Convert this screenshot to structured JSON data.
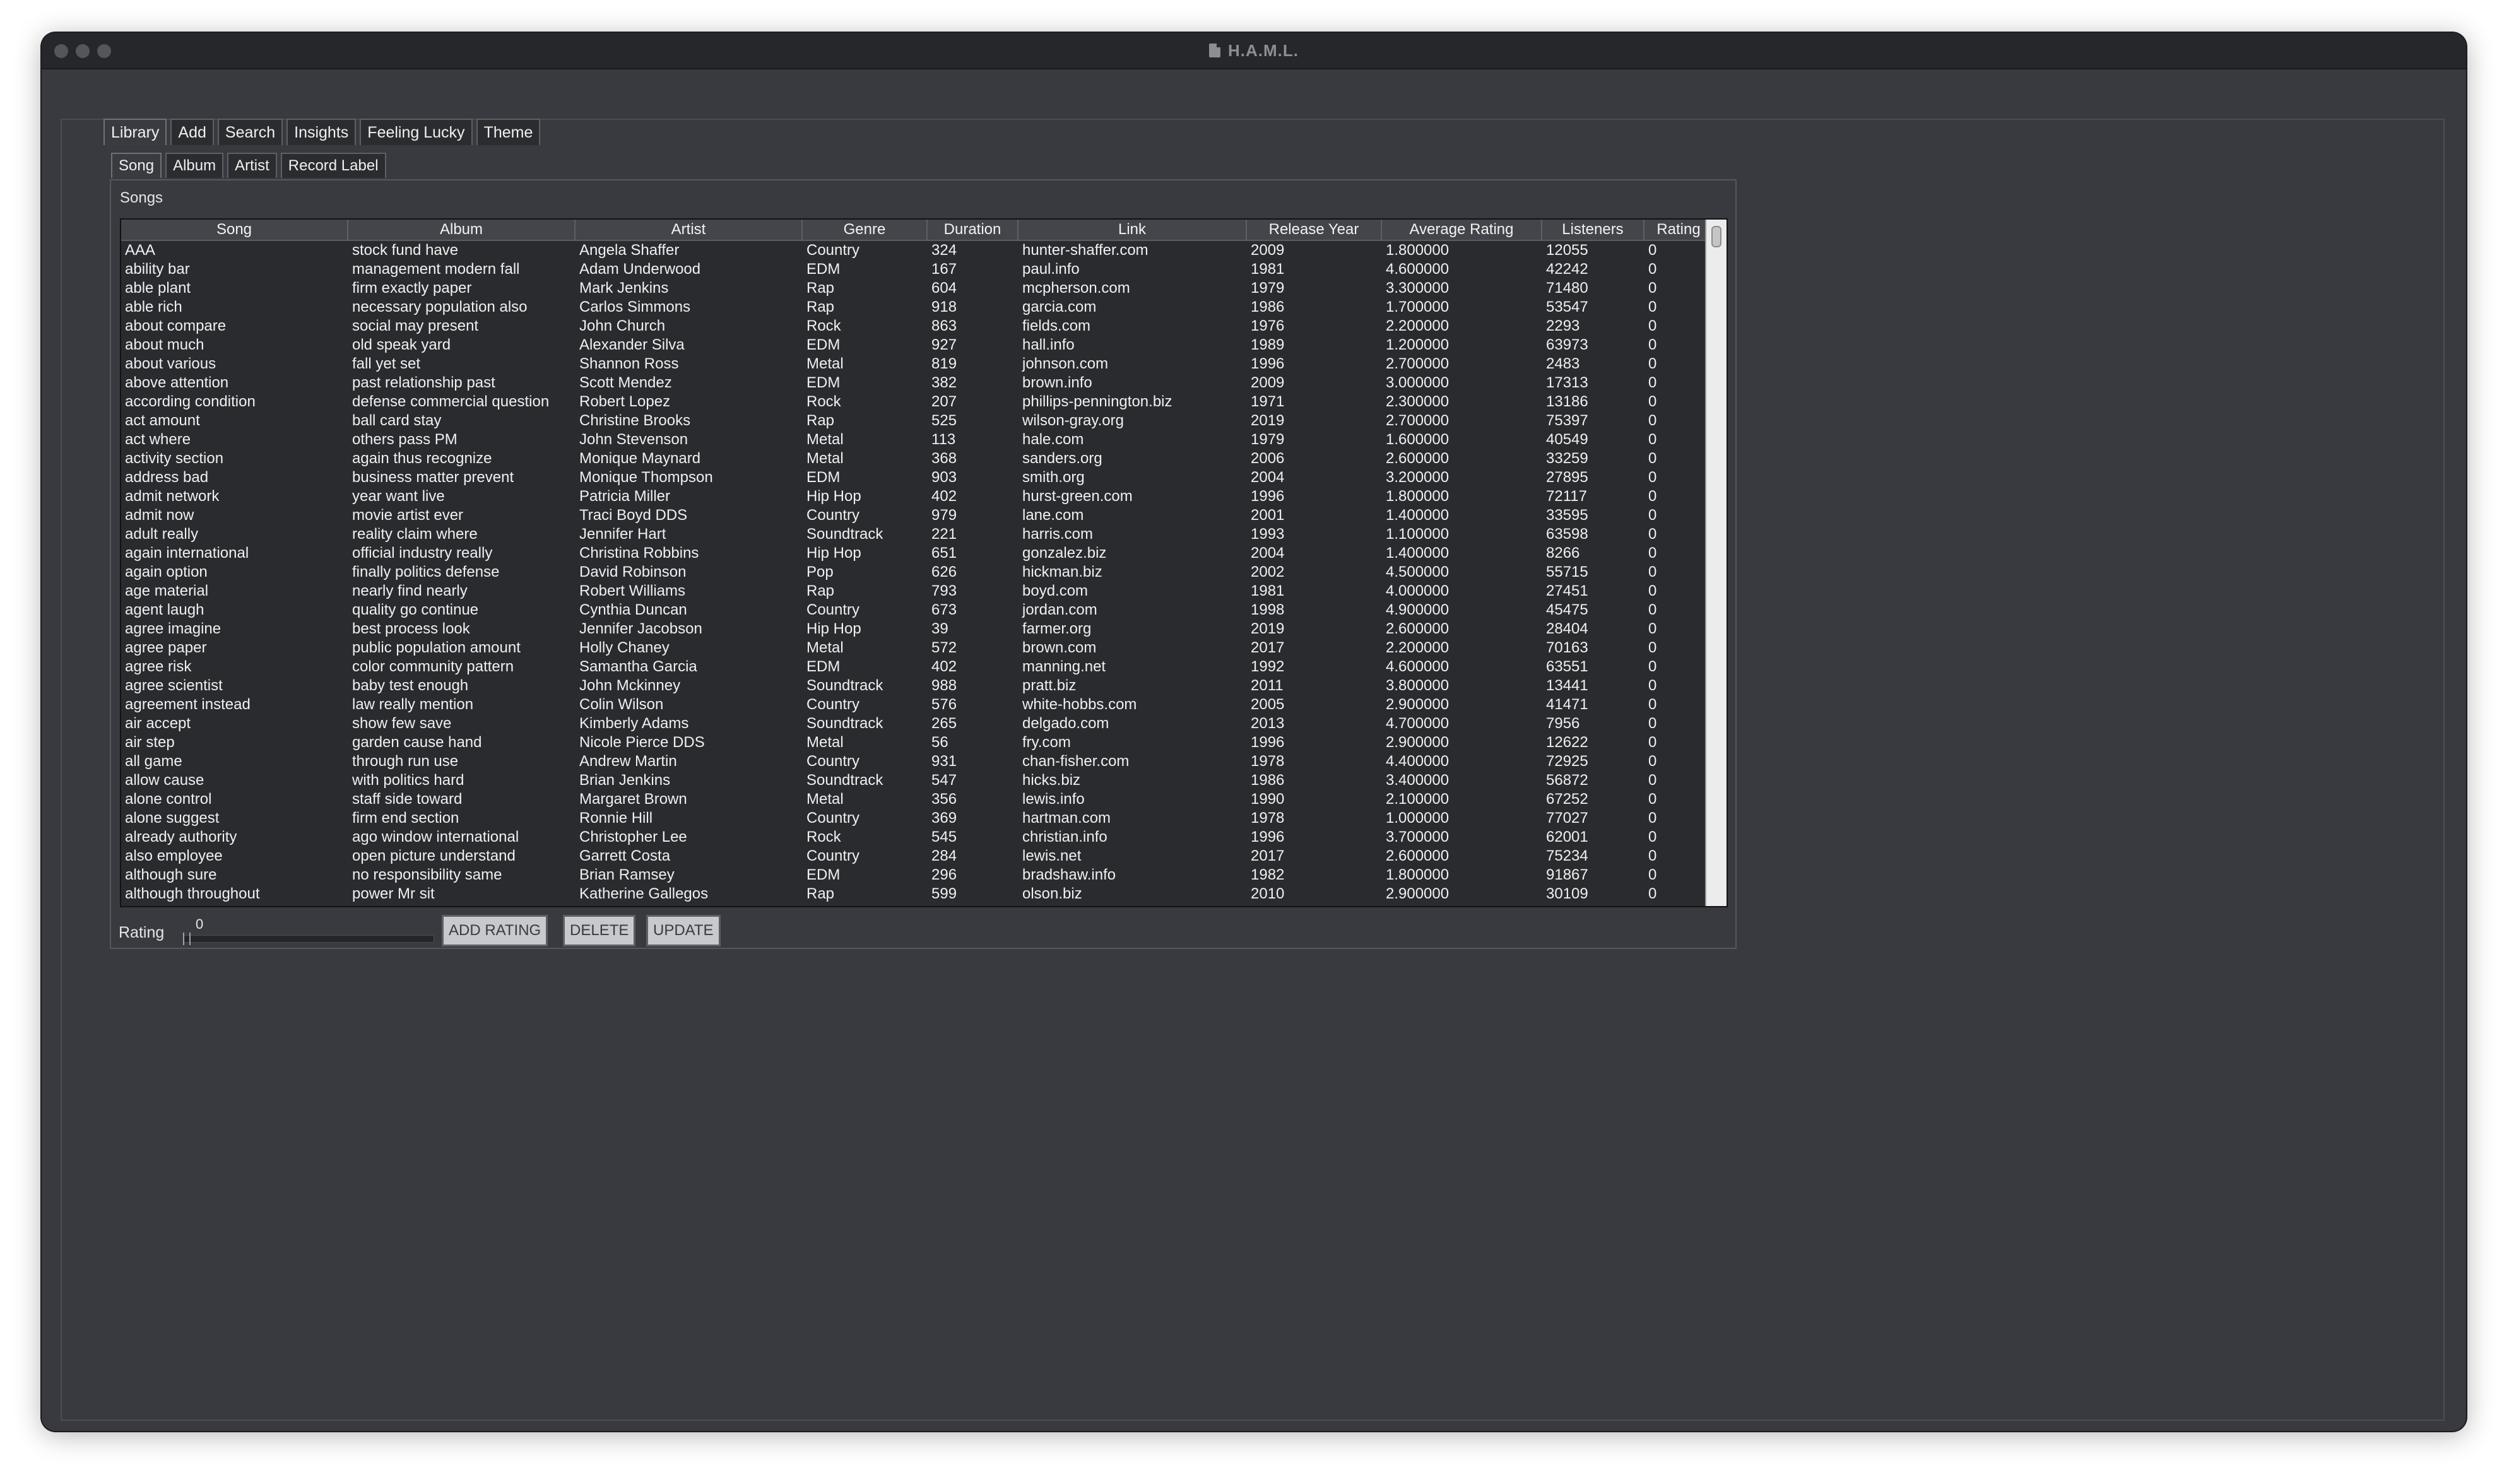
{
  "window": {
    "title": "H.A.M.L."
  },
  "main_tabs": [
    "Library",
    "Add",
    "Search",
    "Insights",
    "Feeling Lucky",
    "Theme"
  ],
  "sub_tabs": [
    "Song",
    "Album",
    "Artist",
    "Record Label"
  ],
  "panel": {
    "title": "Songs"
  },
  "table": {
    "columns": [
      "Song",
      "Album",
      "Artist",
      "Genre",
      "Duration",
      "Link",
      "Release Year",
      "Average Rating",
      "Listeners",
      "Rating"
    ],
    "rows": [
      [
        "AAA",
        "stock fund have",
        "Angela Shaffer",
        "Country",
        "324",
        "hunter-shaffer.com",
        "2009",
        "1.800000",
        "12055",
        "0"
      ],
      [
        "ability bar",
        "management modern fall",
        "Adam Underwood",
        "EDM",
        "167",
        "paul.info",
        "1981",
        "4.600000",
        "42242",
        "0"
      ],
      [
        "able plant",
        "firm exactly paper",
        "Mark Jenkins",
        "Rap",
        "604",
        "mcpherson.com",
        "1979",
        "3.300000",
        "71480",
        "0"
      ],
      [
        "able rich",
        "necessary population also",
        "Carlos Simmons",
        "Rap",
        "918",
        "garcia.com",
        "1986",
        "1.700000",
        "53547",
        "0"
      ],
      [
        "about compare",
        "social may present",
        "John Church",
        "Rock",
        "863",
        "fields.com",
        "1976",
        "2.200000",
        "2293",
        "0"
      ],
      [
        "about much",
        "old speak yard",
        "Alexander Silva",
        "EDM",
        "927",
        "hall.info",
        "1989",
        "1.200000",
        "63973",
        "0"
      ],
      [
        "about various",
        "fall yet set",
        "Shannon Ross",
        "Metal",
        "819",
        "johnson.com",
        "1996",
        "2.700000",
        "2483",
        "0"
      ],
      [
        "above attention",
        "past relationship past",
        "Scott Mendez",
        "EDM",
        "382",
        "brown.info",
        "2009",
        "3.000000",
        "17313",
        "0"
      ],
      [
        "according condition",
        "defense commercial question",
        "Robert Lopez",
        "Rock",
        "207",
        "phillips-pennington.biz",
        "1971",
        "2.300000",
        "13186",
        "0"
      ],
      [
        "act amount",
        "ball card stay",
        "Christine Brooks",
        "Rap",
        "525",
        "wilson-gray.org",
        "2019",
        "2.700000",
        "75397",
        "0"
      ],
      [
        "act where",
        "others pass PM",
        "John Stevenson",
        "Metal",
        "113",
        "hale.com",
        "1979",
        "1.600000",
        "40549",
        "0"
      ],
      [
        "activity section",
        "again thus recognize",
        "Monique Maynard",
        "Metal",
        "368",
        "sanders.org",
        "2006",
        "2.600000",
        "33259",
        "0"
      ],
      [
        "address bad",
        "business matter prevent",
        "Monique Thompson",
        "EDM",
        "903",
        "smith.org",
        "2004",
        "3.200000",
        "27895",
        "0"
      ],
      [
        "admit network",
        "year want live",
        "Patricia Miller",
        "Hip Hop",
        "402",
        "hurst-green.com",
        "1996",
        "1.800000",
        "72117",
        "0"
      ],
      [
        "admit now",
        "movie artist ever",
        "Traci Boyd DDS",
        "Country",
        "979",
        "lane.com",
        "2001",
        "1.400000",
        "33595",
        "0"
      ],
      [
        "adult really",
        "reality claim where",
        "Jennifer Hart",
        "Soundtrack",
        "221",
        "harris.com",
        "1993",
        "1.100000",
        "63598",
        "0"
      ],
      [
        "again international",
        "official industry really",
        "Christina Robbins",
        "Hip Hop",
        "651",
        "gonzalez.biz",
        "2004",
        "1.400000",
        "8266",
        "0"
      ],
      [
        "again option",
        "finally politics defense",
        "David Robinson",
        "Pop",
        "626",
        "hickman.biz",
        "2002",
        "4.500000",
        "55715",
        "0"
      ],
      [
        "age material",
        "nearly find nearly",
        "Robert Williams",
        "Rap",
        "793",
        "boyd.com",
        "1981",
        "4.000000",
        "27451",
        "0"
      ],
      [
        "agent laugh",
        "quality go continue",
        "Cynthia Duncan",
        "Country",
        "673",
        "jordan.com",
        "1998",
        "4.900000",
        "45475",
        "0"
      ],
      [
        "agree imagine",
        "best process look",
        "Jennifer Jacobson",
        "Hip Hop",
        "39",
        "farmer.org",
        "2019",
        "2.600000",
        "28404",
        "0"
      ],
      [
        "agree paper",
        "public population amount",
        "Holly Chaney",
        "Metal",
        "572",
        "brown.com",
        "2017",
        "2.200000",
        "70163",
        "0"
      ],
      [
        "agree risk",
        "color community pattern",
        "Samantha Garcia",
        "EDM",
        "402",
        "manning.net",
        "1992",
        "4.600000",
        "63551",
        "0"
      ],
      [
        "agree scientist",
        "baby test enough",
        "John Mckinney",
        "Soundtrack",
        "988",
        "pratt.biz",
        "2011",
        "3.800000",
        "13441",
        "0"
      ],
      [
        "agreement instead",
        "law really mention",
        "Colin Wilson",
        "Country",
        "576",
        "white-hobbs.com",
        "2005",
        "2.900000",
        "41471",
        "0"
      ],
      [
        "air accept",
        "show few save",
        "Kimberly Adams",
        "Soundtrack",
        "265",
        "delgado.com",
        "2013",
        "4.700000",
        "7956",
        "0"
      ],
      [
        "air step",
        "garden cause hand",
        "Nicole Pierce DDS",
        "Metal",
        "56",
        "fry.com",
        "1996",
        "2.900000",
        "12622",
        "0"
      ],
      [
        "all game",
        "through run use",
        "Andrew Martin",
        "Country",
        "931",
        "chan-fisher.com",
        "1978",
        "4.400000",
        "72925",
        "0"
      ],
      [
        "allow cause",
        "with politics hard",
        "Brian Jenkins",
        "Soundtrack",
        "547",
        "hicks.biz",
        "1986",
        "3.400000",
        "56872",
        "0"
      ],
      [
        "alone control",
        "staff side toward",
        "Margaret Brown",
        "Metal",
        "356",
        "lewis.info",
        "1990",
        "2.100000",
        "67252",
        "0"
      ],
      [
        "alone suggest",
        "firm end section",
        "Ronnie Hill",
        "Country",
        "369",
        "hartman.com",
        "1978",
        "1.000000",
        "77027",
        "0"
      ],
      [
        "already authority",
        "ago window international",
        "Christopher Lee",
        "Rock",
        "545",
        "christian.info",
        "1996",
        "3.700000",
        "62001",
        "0"
      ],
      [
        "also employee",
        "open picture understand",
        "Garrett Costa",
        "Country",
        "284",
        "lewis.net",
        "2017",
        "2.600000",
        "75234",
        "0"
      ],
      [
        "although sure",
        "no responsibility same",
        "Brian Ramsey",
        "EDM",
        "296",
        "bradshaw.info",
        "1982",
        "1.800000",
        "91867",
        "0"
      ],
      [
        "although throughout",
        "power Mr sit",
        "Katherine Gallegos",
        "Rap",
        "599",
        "olson.biz",
        "2010",
        "2.900000",
        "30109",
        "0"
      ]
    ]
  },
  "rating_control": {
    "label": "Rating",
    "value": "0"
  },
  "buttons": {
    "add_rating": "ADD RATING",
    "delete": "DELETE",
    "update": "UPDATE"
  }
}
